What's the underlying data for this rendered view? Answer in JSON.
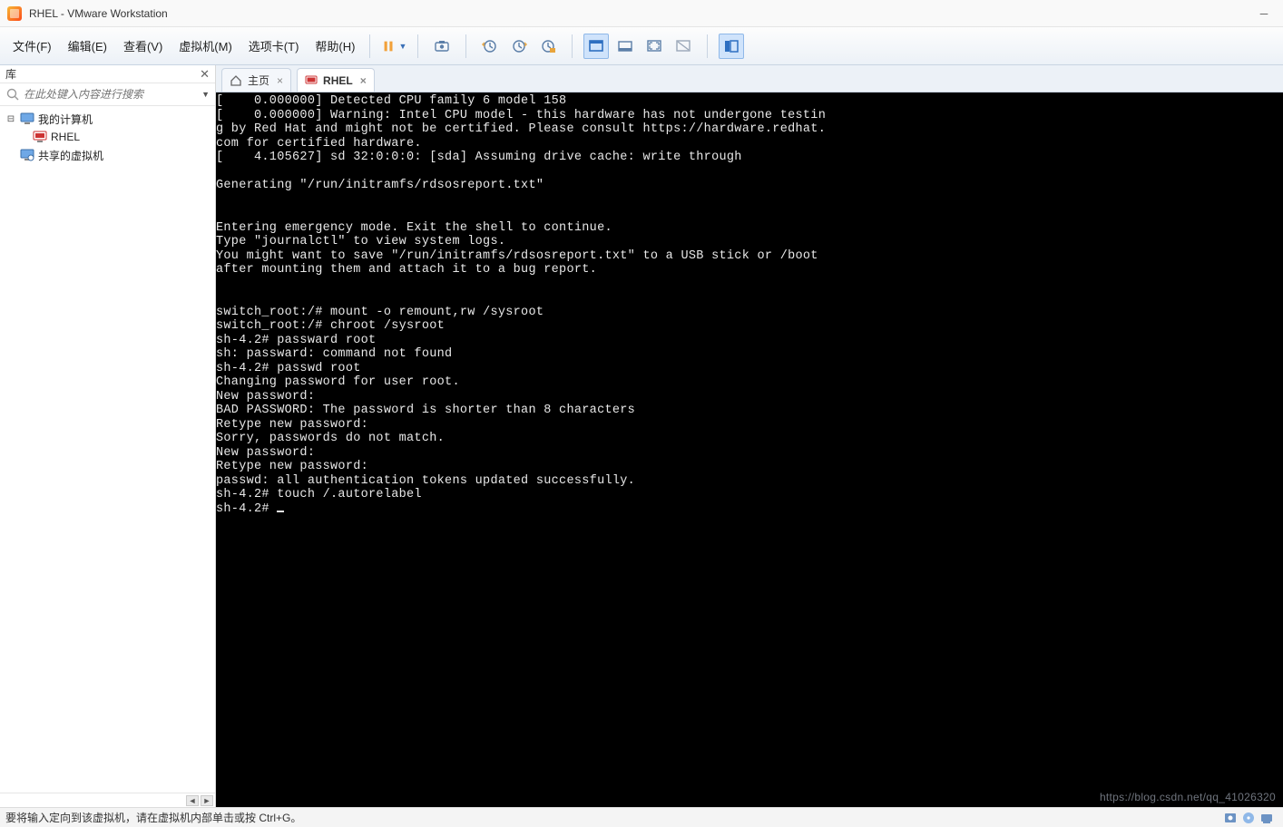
{
  "window": {
    "title": "RHEL - VMware Workstation"
  },
  "menu": {
    "items": [
      "文件(F)",
      "编辑(E)",
      "查看(V)",
      "虚拟机(M)",
      "选项卡(T)",
      "帮助(H)"
    ]
  },
  "sidebar": {
    "title": "库",
    "search_placeholder": "在此处键入内容进行搜索",
    "tree": {
      "root": "我的计算机",
      "child": "RHEL",
      "shared": "共享的虚拟机"
    }
  },
  "tabs": {
    "home": "主页",
    "vm": "RHEL"
  },
  "terminal_lines": [
    "[    0.000000] Detected CPU family 6 model 158",
    "[    0.000000] Warning: Intel CPU model - this hardware has not undergone testin",
    "g by Red Hat and might not be certified. Please consult https://hardware.redhat.",
    "com for certified hardware.",
    "[    4.105627] sd 32:0:0:0: [sda] Assuming drive cache: write through",
    "",
    "Generating \"/run/initramfs/rdsosreport.txt\"",
    "",
    "",
    "Entering emergency mode. Exit the shell to continue.",
    "Type \"journalctl\" to view system logs.",
    "You might want to save \"/run/initramfs/rdsosreport.txt\" to a USB stick or /boot",
    "after mounting them and attach it to a bug report.",
    "",
    "",
    "switch_root:/# mount -o remount,rw /sysroot",
    "switch_root:/# chroot /sysroot",
    "sh-4.2# passward root",
    "sh: passward: command not found",
    "sh-4.2# passwd root",
    "Changing password for user root.",
    "New password:",
    "BAD PASSWORD: The password is shorter than 8 characters",
    "Retype new password:",
    "Sorry, passwords do not match.",
    "New password:",
    "Retype new password:",
    "passwd: all authentication tokens updated successfully.",
    "sh-4.2# touch /.autorelabel",
    "sh-4.2# "
  ],
  "status": {
    "text": "要将输入定向到该虚拟机，请在虚拟机内部单击或按 Ctrl+G。"
  },
  "watermark": "https://blog.csdn.net/qq_41026320",
  "icons": {
    "pause": "pause-icon",
    "dropdown": "dropdown-icon",
    "snapshot": "snapshot-icon",
    "clockA": "clock-back-icon",
    "clockB": "clock-forward-icon",
    "clockC": "clock-manage-icon",
    "view1": "view-console-icon",
    "view2": "view-unity-icon",
    "view3": "view-fullscreen-icon",
    "view4": "view-stretch-icon",
    "library": "library-view-icon"
  }
}
